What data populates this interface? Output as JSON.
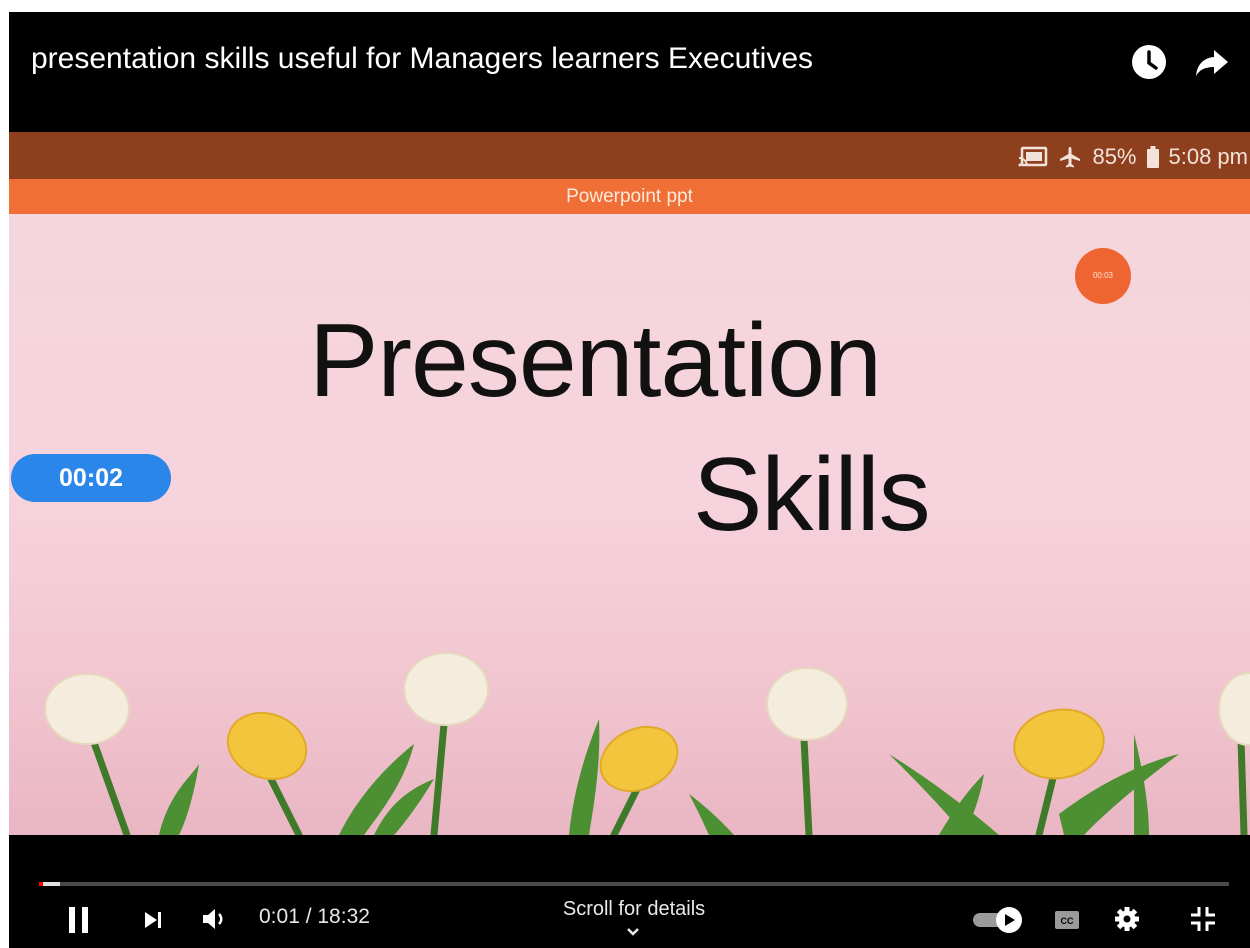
{
  "video": {
    "title": "presentation skills useful for Managers learners Executives"
  },
  "status_bar": {
    "battery": "85%",
    "time": "5:08 pm"
  },
  "app_bar": {
    "title": "Powerpoint ppt"
  },
  "slide": {
    "title_line1": "Presentation",
    "title_line2": "Skills",
    "rec_badge": "00:03",
    "timer_pill": "00:02"
  },
  "controls": {
    "time": "0:01 / 18:32",
    "scroll_hint": "Scroll for details",
    "progress_fraction": 0.018
  },
  "icons": [
    "watch-later-icon",
    "share-icon",
    "cast-icon",
    "airplane-icon",
    "battery-icon",
    "pause-icon",
    "next-icon",
    "volume-icon",
    "autoplay-toggle-icon",
    "captions-icon",
    "settings-icon",
    "exit-fullscreen-icon",
    "chevron-down-icon"
  ],
  "colors": {
    "status_bar": "#8e3f1e",
    "app_bar": "#ef6f36",
    "timer_pill": "#2a86e8",
    "rec_badge": "#ef6532",
    "progress_start": "#ff0000"
  }
}
